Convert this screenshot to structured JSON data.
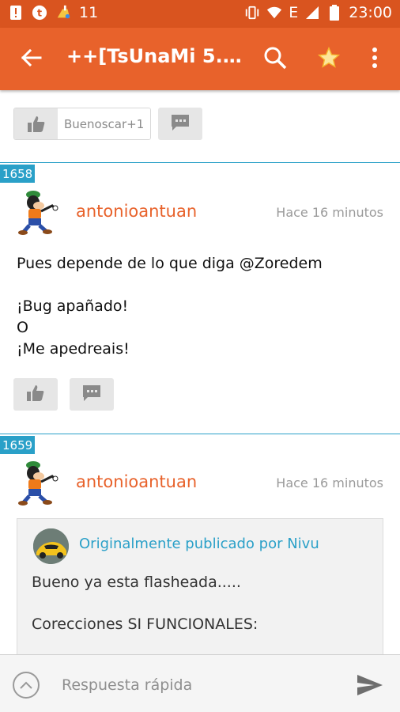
{
  "status_bar": {
    "notification_count": "11",
    "time": "23:00",
    "network_label": "E",
    "icons": [
      "alert-icon",
      "t-app-icon",
      "cleaner-icon",
      "vibrate-icon",
      "wifi-icon",
      "signal-icon",
      "battery-icon"
    ]
  },
  "app_bar": {
    "title": "++[TsUnaMi 5.1...",
    "icons": [
      "back-arrow-icon",
      "search-icon",
      "star-icon",
      "more-vert-icon"
    ]
  },
  "top_actions": {
    "liked_by": "Buenoscar+1"
  },
  "posts": [
    {
      "number": "1658",
      "username": "antonioantuan",
      "time": "Hace 16 minutos",
      "lines": [
        "Pues depende de lo que diga @Zoredem",
        "",
        "¡Bug apañado!",
        "O",
        "¡Me apedreais!"
      ]
    },
    {
      "number": "1659",
      "username": "antonioantuan",
      "time": "Hace 16 minutos",
      "quote": {
        "header": "Originalmente publicado por Nivu",
        "line1": "Bueno ya esta flasheada.....",
        "line2": "Corecciones SI FUNCIONALES:"
      }
    }
  ],
  "bottom_bar": {
    "reply_placeholder": "Respuesta rápida"
  },
  "colors": {
    "status_bar": "#d9541f",
    "app_bar": "#e8622b",
    "username": "#e8622b",
    "accent_blue": "#2aa0c8",
    "button_gray": "#e6e6e6"
  }
}
